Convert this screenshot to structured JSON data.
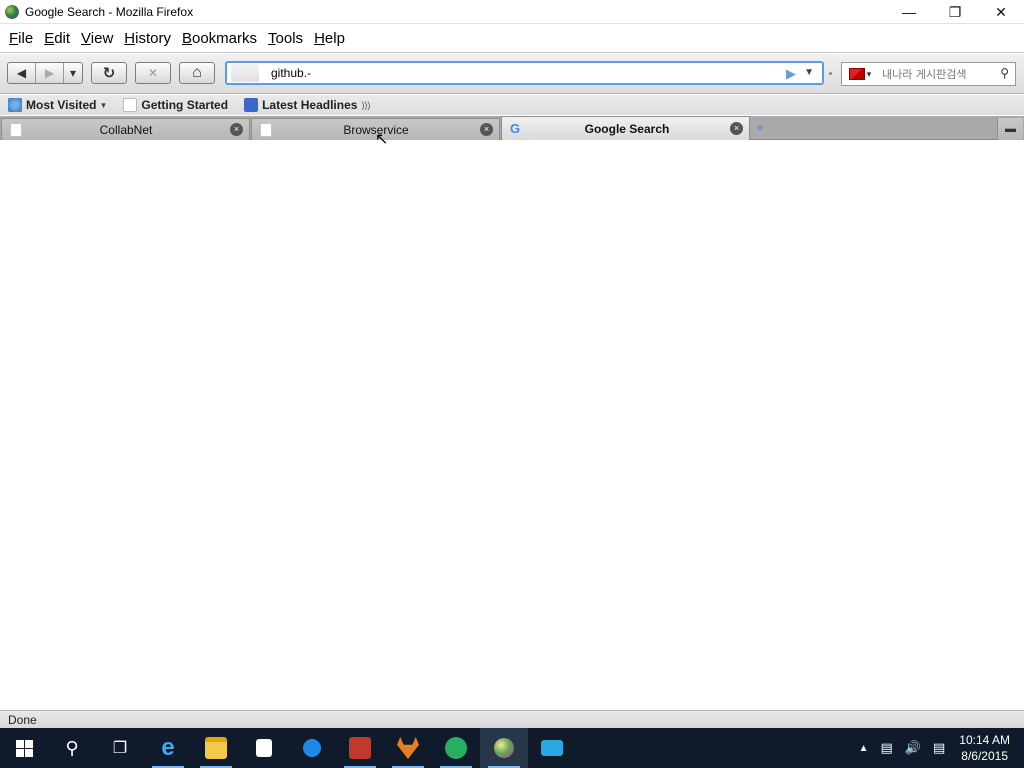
{
  "window": {
    "title": "Google Search - Mozilla Firefox",
    "controls": {
      "minimize": "—",
      "maximize": "❐",
      "close": "✕"
    }
  },
  "menu": {
    "items": [
      {
        "key": "F",
        "rest": "ile"
      },
      {
        "key": "E",
        "rest": "dit"
      },
      {
        "key": "V",
        "rest": "iew"
      },
      {
        "key": "H",
        "rest": "istory"
      },
      {
        "key": "B",
        "rest": "ookmarks"
      },
      {
        "key": "T",
        "rest": "ools"
      },
      {
        "key": "H",
        "rest": "elp"
      }
    ]
  },
  "navbar": {
    "back": "◀",
    "forward": "▶",
    "history_dropdown": "▾",
    "reload": "↻",
    "stop": "✕",
    "home": "⌂",
    "url_value": "github.-",
    "go": "▶",
    "url_dropdown": "▼",
    "search_placeholder": "내나라 게시판검색",
    "search_icon": "🔍"
  },
  "bookmarks": {
    "items": [
      {
        "label": "Most Visited",
        "icon": "most-visited-icon"
      },
      {
        "label": "Getting Started",
        "icon": "page-icon"
      },
      {
        "label": "Latest Headlines",
        "icon": "feed-icon"
      }
    ]
  },
  "tabs": [
    {
      "label": "CollabNet",
      "active": false
    },
    {
      "label": "Browservice",
      "active": false
    },
    {
      "label": "Google Search",
      "active": true
    }
  ],
  "tab_close": "×",
  "new_tab": "+",
  "status": {
    "text": "Done"
  },
  "taskbar": {
    "time": "10:14 AM",
    "date": "8/6/2015"
  },
  "colors": {
    "url_focus": "#5a9ae6",
    "taskbar_bg": "#0f1b2a"
  }
}
